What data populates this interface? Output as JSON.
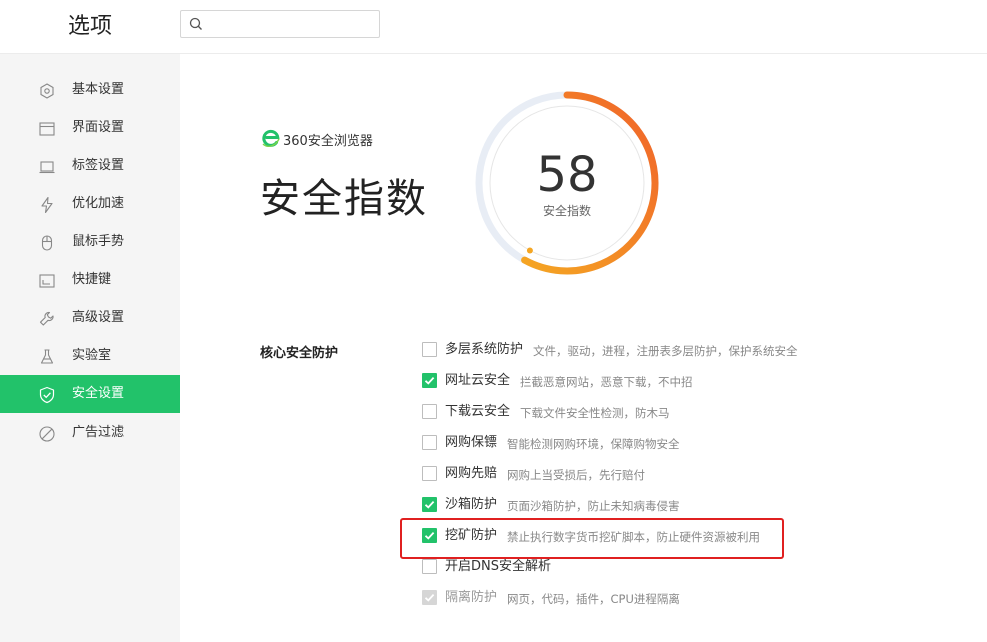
{
  "header": {
    "title": "选项",
    "search": {
      "value": "",
      "placeholder": ""
    }
  },
  "sidebar": {
    "items": [
      {
        "label": "基本设置",
        "icon": "hexagon-icon",
        "active": false
      },
      {
        "label": "界面设置",
        "icon": "window-icon",
        "active": false
      },
      {
        "label": "标签设置",
        "icon": "tab-icon",
        "active": false
      },
      {
        "label": "优化加速",
        "icon": "lightning-icon",
        "active": false
      },
      {
        "label": "鼠标手势",
        "icon": "mouse-icon",
        "active": false
      },
      {
        "label": "快捷键",
        "icon": "keyboard-icon",
        "active": false
      },
      {
        "label": "高级设置",
        "icon": "wrench-icon",
        "active": false
      },
      {
        "label": "实验室",
        "icon": "flask-icon",
        "active": false
      },
      {
        "label": "安全设置",
        "icon": "shield-check-icon",
        "active": true
      },
      {
        "label": "广告过滤",
        "icon": "block-icon",
        "active": false
      }
    ]
  },
  "main": {
    "brand": "360安全浏览器",
    "title": "安全指数",
    "score": {
      "value": "58",
      "label": "安全指数",
      "fraction": 0.58
    },
    "section_label": "核心安全防护",
    "options": [
      {
        "title": "多层系统防护",
        "desc": "文件，驱动，进程，注册表多层防护，保护系统安全",
        "checked": false,
        "disabled": false
      },
      {
        "title": "网址云安全",
        "desc": "拦截恶意网站，恶意下载，不中招",
        "checked": true,
        "disabled": false
      },
      {
        "title": "下载云安全",
        "desc": "下载文件安全性检测，防木马",
        "checked": false,
        "disabled": false
      },
      {
        "title": "网购保镖",
        "desc": "智能检测网购环境，保障购物安全",
        "checked": false,
        "disabled": false
      },
      {
        "title": "网购先赔",
        "desc": "网购上当受损后，先行赔付",
        "checked": false,
        "disabled": false
      },
      {
        "title": "沙箱防护",
        "desc": "页面沙箱防护，防止未知病毒侵害",
        "checked": true,
        "disabled": false
      },
      {
        "title": "挖矿防护",
        "desc": "禁止执行数字货币挖矿脚本，防止硬件资源被利用",
        "checked": true,
        "disabled": false
      },
      {
        "title": "开启DNS安全解析",
        "desc": "",
        "checked": false,
        "disabled": false
      },
      {
        "title": "隔离防护",
        "desc": "网页，代码，插件，CPU进程隔离",
        "checked": true,
        "disabled": true
      }
    ]
  },
  "colors": {
    "accent": "#22c26a",
    "gauge_start": "#f5a623",
    "gauge_end": "#f0632a",
    "gauge_track": "#e8edf5",
    "highlight": "#e02020"
  }
}
